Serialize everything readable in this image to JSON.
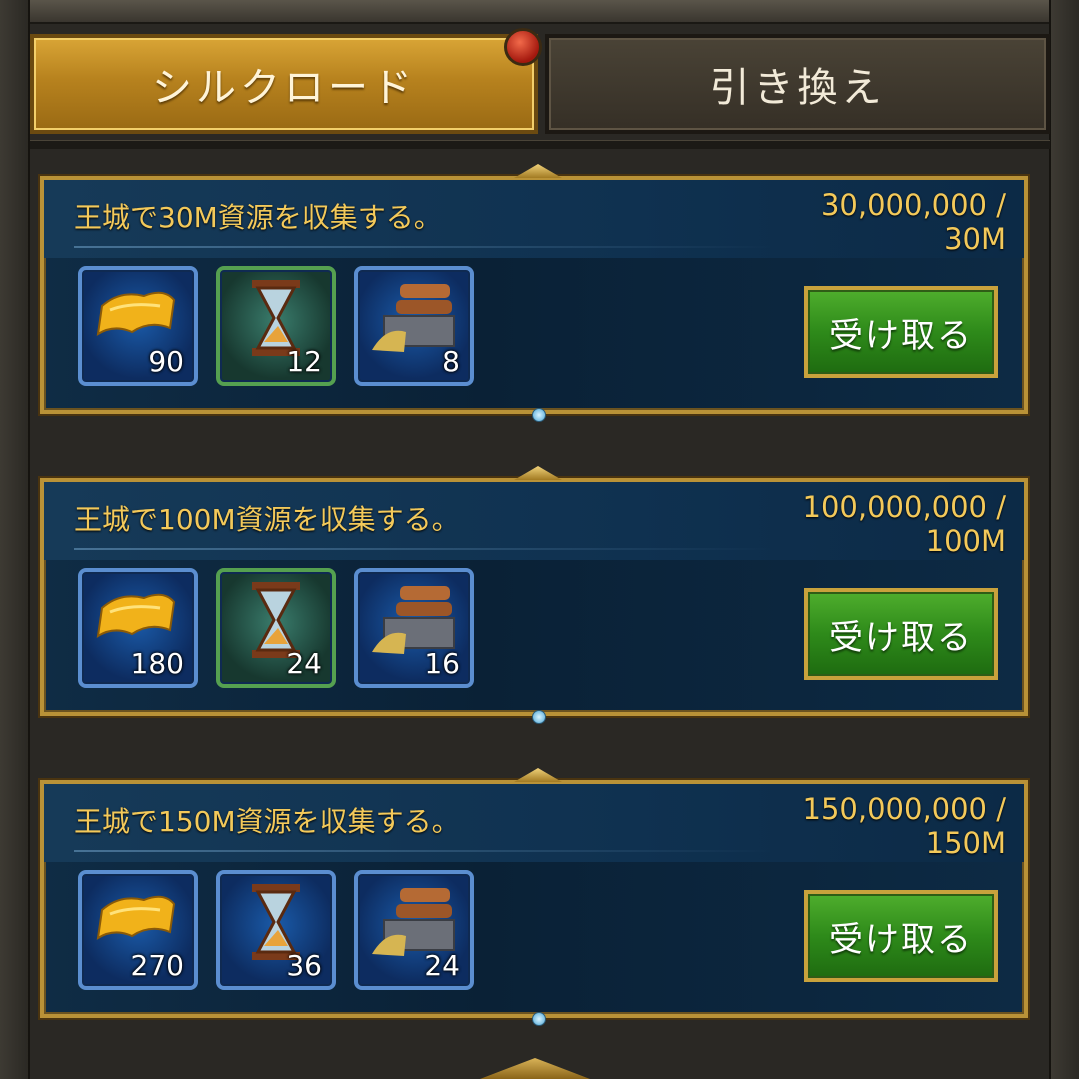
{
  "tabs": [
    {
      "label": "シルクロード",
      "active": true
    },
    {
      "label": "引き換え",
      "active": false
    }
  ],
  "tasks": [
    {
      "description": "王城で30M資源を収集する。",
      "progress_line1": "30,000,000 /",
      "progress_line2": "30M",
      "rewards": [
        {
          "icon": "scroll-icon",
          "count": "90"
        },
        {
          "icon": "hourglass-icon",
          "count": "12"
        },
        {
          "icon": "resource-crate-icon",
          "count": "8"
        }
      ],
      "claim_label": "受け取る"
    },
    {
      "description": "王城で100M資源を収集する。",
      "progress_line1": "100,000,000 /",
      "progress_line2": "100M",
      "rewards": [
        {
          "icon": "scroll-icon",
          "count": "180"
        },
        {
          "icon": "hourglass-icon",
          "count": "24"
        },
        {
          "icon": "resource-crate-icon",
          "count": "16"
        }
      ],
      "claim_label": "受け取る"
    },
    {
      "description": "王城で150M資源を収集する。",
      "progress_line1": "150,000,000 /",
      "progress_line2": "150M",
      "rewards": [
        {
          "icon": "scroll-icon",
          "count": "270"
        },
        {
          "icon": "hourglass-icon",
          "count": "36"
        },
        {
          "icon": "resource-crate-icon",
          "count": "24"
        }
      ],
      "claim_label": "受け取る"
    }
  ],
  "colors": {
    "gold_text": "#f3c95a",
    "claim_green": "#2e8a1a",
    "tab_gold": "#c08a24"
  }
}
